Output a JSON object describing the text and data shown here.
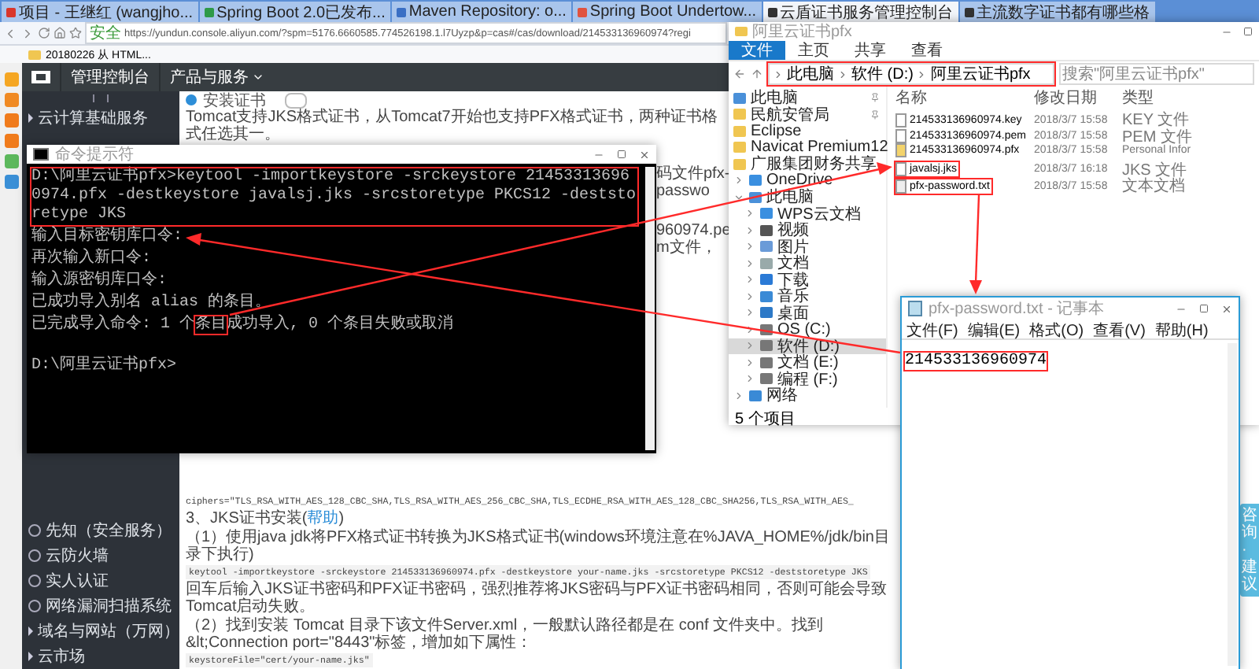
{
  "browser": {
    "tabs": [
      {
        "label": "项目 - 王继红 (wangjho...",
        "selected": false,
        "color": "#d9362b"
      },
      {
        "label": "Spring Boot 2.0已发布...",
        "selected": false,
        "color": "#2e9a48"
      },
      {
        "label": "Maven Repository: o...",
        "selected": false,
        "color": "#3a6fc4"
      },
      {
        "label": "Spring Boot Undertow...",
        "selected": false,
        "color": "#e0533f"
      },
      {
        "label": "云盾证书服务管理控制台",
        "selected": true,
        "color": "#333333"
      },
      {
        "label": "主流数字证书都有哪些格",
        "selected": false,
        "color": "#333333"
      }
    ],
    "secure_label": "安全",
    "url": "https://yundun.console.aliyun.com/?spm=5176.6660585.774526198.1.l7Uyzp&p=cas#/cas/download/214533136960974?regi",
    "bookmark": "20180226 从 HTML..."
  },
  "console": {
    "header": {
      "home": "管理控制台",
      "products": "产品与服务"
    },
    "sidebar_top": [
      {
        "label": "云计算基础服务"
      }
    ],
    "sidebar_bottom": [
      {
        "label": "先知（安全服务）",
        "kind": "icon"
      },
      {
        "label": "云防火墙",
        "kind": "icon"
      },
      {
        "label": "实人认证",
        "kind": "icon"
      },
      {
        "label": "网络漏洞扫描系统",
        "kind": "icon"
      },
      {
        "label": "域名与网站（万网）",
        "kind": "arrow"
      },
      {
        "label": "云市场",
        "kind": "arrow"
      }
    ],
    "section_title": "安装证书",
    "intro": "Tomcat支持JKS格式证书，从Tomcat7开始也支持PFX格式证书，两种证书格式任选其一。",
    "fragments": [
      "码文件pfx-passwo",
      "960974.pem文件，"
    ],
    "ciphers": "ciphers=\"TLS_RSA_WITH_AES_128_CBC_SHA,TLS_RSA_WITH_AES_256_CBC_SHA,TLS_ECDHE_RSA_WITH_AES_128_CBC_SHA256,TLS_RSA_WITH_AES_",
    "jks_title": "3、JKS证书安装(",
    "jks_help": "帮助",
    "jks_close": ")",
    "step1": "（1）使用java jdk将PFX格式证书转换为JKS格式证书(windows环境注意在%JAVA_HOME%/jdk/bin目录下执行)",
    "command": "keytool -importkeystore -srckeystore 214533136960974.pfx -destkeystore your-name.jks -srcstoretype PKCS12 -deststoretype JKS",
    "note": "回车后输入JKS证书密码和PFX证书密码，强烈推荐将JKS密码与PFX证书密码相同，否则可能会导致Tomcat启动失败。",
    "step2": "（2）找到安装 Tomcat 目录下该文件Server.xml，一般默认路径都是在 conf 文件夹中。找到 &lt;Connection port=\"8443\"标签，增加如下属性：",
    "keystore_line": "keystoreFile=\"cert/your-name.jks\"",
    "feedback": "咨询·建议"
  },
  "cmd": {
    "title": "命令提示符",
    "lines": [
      {
        "text": "D:\\阿里云证书pfx>keytool -importkeystore -srckeystore 214533136960974.pfx -destkeystore javalsj.jks -srcstoretype PKCS12 -deststoretype JKS",
        "highlighted": true
      },
      {
        "text": "输入目标密钥库口令:",
        "highlighted": false
      },
      {
        "text": "再次输入新口令:",
        "highlighted": false
      },
      {
        "text": "输入源密钥库口令:",
        "highlighted": false
      },
      {
        "text": "已成功导入别名 alias 的条目。",
        "highlighted": false
      },
      {
        "text": "已完成导入命令: 1 个",
        "highlight": "条目",
        "after": "成功导入, 0 个条目失败或取消",
        "highlighted": false
      },
      {
        "text": "D:\\阿里云证书pfx>",
        "highlighted": false
      }
    ]
  },
  "explorer": {
    "title": "阿里云证书pfx",
    "ribbon_tabs": [
      {
        "label": "文件",
        "selected": true
      },
      {
        "label": "主页",
        "selected": false
      },
      {
        "label": "共享",
        "selected": false
      },
      {
        "label": "查看",
        "selected": false
      }
    ],
    "breadcrumb": {
      "parts": [
        "此电脑",
        "软件 (D:)",
        "阿里云证书pfx"
      ],
      "highlighted": true
    },
    "search": {
      "placeholder": "搜索\"阿里云证书pfx\""
    },
    "nav": [
      {
        "label": "此电脑",
        "kind": "pc",
        "pinned": true,
        "selected": false
      },
      {
        "label": "民航安管局",
        "kind": "folder",
        "pinned": true,
        "selected": false
      },
      {
        "label": "Eclipse",
        "kind": "folder",
        "pinned": false,
        "selected": false
      },
      {
        "label": "Navicat Premium12",
        "kind": "folder",
        "pinned": false,
        "selected": false
      },
      {
        "label": "广服集团财务共享",
        "kind": "folder",
        "pinned": false,
        "selected": false
      },
      {
        "label": "OneDrive",
        "kind": "cloud",
        "expanded": false,
        "selected": false
      },
      {
        "label": "此电脑",
        "kind": "pc",
        "expanded": true,
        "selected": false,
        "children": [
          {
            "label": "WPS云文档",
            "kind": "cloud",
            "expanded": false,
            "selected": false
          },
          {
            "label": "视频",
            "kind": "video",
            "expanded": false,
            "selected": false
          },
          {
            "label": "图片",
            "kind": "image",
            "expanded": false,
            "selected": false
          },
          {
            "label": "文档",
            "kind": "doc",
            "expanded": false,
            "selected": false
          },
          {
            "label": "下载",
            "kind": "download",
            "expanded": false,
            "selected": false
          },
          {
            "label": "音乐",
            "kind": "music",
            "expanded": false,
            "selected": false
          },
          {
            "label": "桌面",
            "kind": "desktop",
            "expanded": false,
            "selected": false
          },
          {
            "label": "OS (C:)",
            "kind": "drive",
            "expanded": false,
            "selected": false
          },
          {
            "label": "软件 (D:)",
            "kind": "drive",
            "expanded": false,
            "selected": true
          },
          {
            "label": "文档 (E:)",
            "kind": "drive",
            "expanded": false,
            "selected": false
          },
          {
            "label": "编程 (F:)",
            "kind": "drive",
            "expanded": false,
            "selected": false
          }
        ]
      },
      {
        "label": "网络",
        "kind": "network",
        "expanded": false,
        "selected": false
      }
    ],
    "columns": [
      "名称",
      "修改日期",
      "类型"
    ],
    "files": [
      {
        "name": "214533136960974.key",
        "date": "2018/3/7 15:58",
        "type": "KEY 文件",
        "kind": "file",
        "highlighted": false
      },
      {
        "name": "214533136960974.pem",
        "date": "2018/3/7 15:58",
        "type": "PEM 文件",
        "kind": "file",
        "highlighted": false
      },
      {
        "name": "214533136960974.pfx",
        "date": "2018/3/7 15:58",
        "type": "Personal Infor",
        "kind": "cert",
        "highlighted": false
      },
      {
        "name": "javalsj.jks",
        "date": "2018/3/7 16:18",
        "type": "JKS 文件",
        "kind": "file",
        "highlighted": true
      },
      {
        "name": "pfx-password.txt",
        "date": "2018/3/7 15:58",
        "type": "文本文档",
        "kind": "text",
        "highlighted": true
      }
    ],
    "status": "5 个项目"
  },
  "notepad": {
    "title": "pfx-password.txt - 记事本",
    "menu": [
      "文件(F)",
      "编辑(E)",
      "格式(O)",
      "查看(V)",
      "帮助(H)"
    ],
    "content": "214533136960974",
    "highlighted": true
  }
}
